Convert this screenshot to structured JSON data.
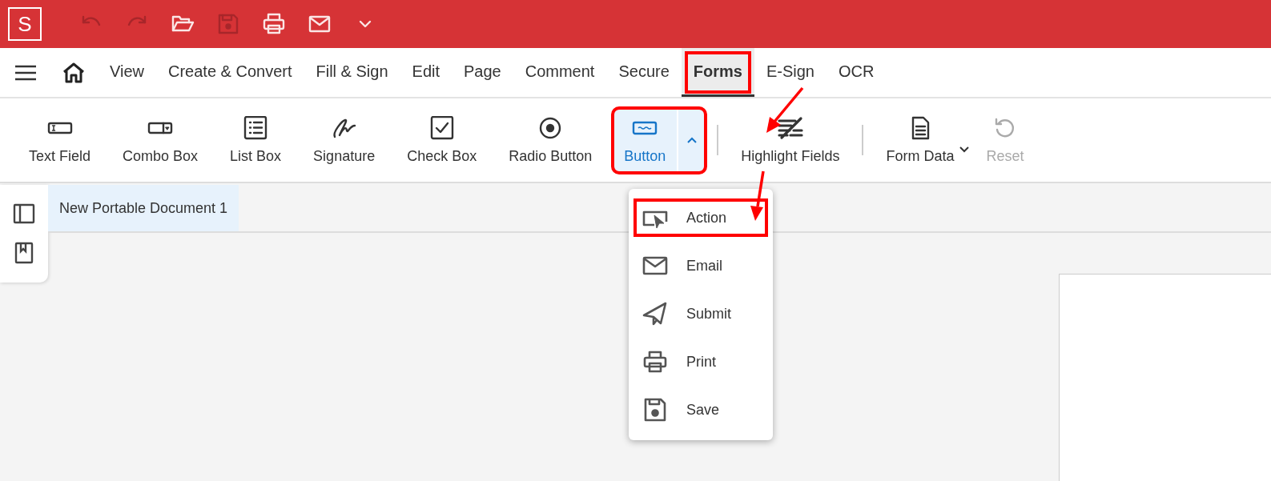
{
  "app_bar": {
    "logo": "S",
    "quick_actions": [
      {
        "kind": "undo",
        "disabled": true
      },
      {
        "kind": "redo",
        "disabled": true
      },
      {
        "kind": "open",
        "disabled": false
      },
      {
        "kind": "save",
        "disabled": true
      },
      {
        "kind": "print",
        "disabled": false
      },
      {
        "kind": "email",
        "disabled": false
      },
      {
        "kind": "more",
        "disabled": false
      }
    ]
  },
  "menu_tabs": [
    {
      "label": "View",
      "selected": false,
      "highlighted": false
    },
    {
      "label": "Create & Convert",
      "selected": false,
      "highlighted": false
    },
    {
      "label": "Fill & Sign",
      "selected": false,
      "highlighted": false
    },
    {
      "label": "Edit",
      "selected": false,
      "highlighted": false
    },
    {
      "label": "Page",
      "selected": false,
      "highlighted": false
    },
    {
      "label": "Comment",
      "selected": false,
      "highlighted": false
    },
    {
      "label": "Secure",
      "selected": false,
      "highlighted": false
    },
    {
      "label": "Forms",
      "selected": true,
      "highlighted": true
    },
    {
      "label": "E-Sign",
      "selected": false,
      "highlighted": false
    },
    {
      "label": "OCR",
      "selected": false,
      "highlighted": false
    }
  ],
  "ribbon": [
    {
      "label": "Text Field",
      "kind": "text-field",
      "selected": false,
      "disabled": false
    },
    {
      "label": "Combo Box",
      "kind": "combo-box",
      "selected": false,
      "disabled": false
    },
    {
      "label": "List Box",
      "kind": "list-box",
      "selected": false,
      "disabled": false
    },
    {
      "label": "Signature",
      "kind": "signature",
      "selected": false,
      "disabled": false
    },
    {
      "label": "Check Box",
      "kind": "check-box",
      "selected": false,
      "disabled": false
    },
    {
      "label": "Radio Button",
      "kind": "radio-button",
      "selected": false,
      "disabled": false
    },
    {
      "label": "Button",
      "kind": "button",
      "selected": true,
      "disabled": false,
      "split": true,
      "expanded": true,
      "highlighted": true,
      "separator_after": true
    },
    {
      "label": "Highlight Fields",
      "kind": "highlight-fields",
      "selected": false,
      "disabled": false,
      "separator_after": true
    },
    {
      "label": "Form Data",
      "kind": "form-data",
      "selected": false,
      "disabled": false,
      "dropdown": true
    },
    {
      "label": "Reset",
      "kind": "reset",
      "selected": false,
      "disabled": true
    }
  ],
  "document_tabs": [
    {
      "label": "New Portable Document 1",
      "selected": true
    }
  ],
  "button_menu": [
    {
      "label": "Action",
      "kind": "action",
      "highlighted": true
    },
    {
      "label": "Email",
      "kind": "email",
      "highlighted": false
    },
    {
      "label": "Submit",
      "kind": "submit",
      "highlighted": false
    },
    {
      "label": "Print",
      "kind": "print",
      "highlighted": false
    },
    {
      "label": "Save",
      "kind": "save",
      "highlighted": false
    }
  ]
}
